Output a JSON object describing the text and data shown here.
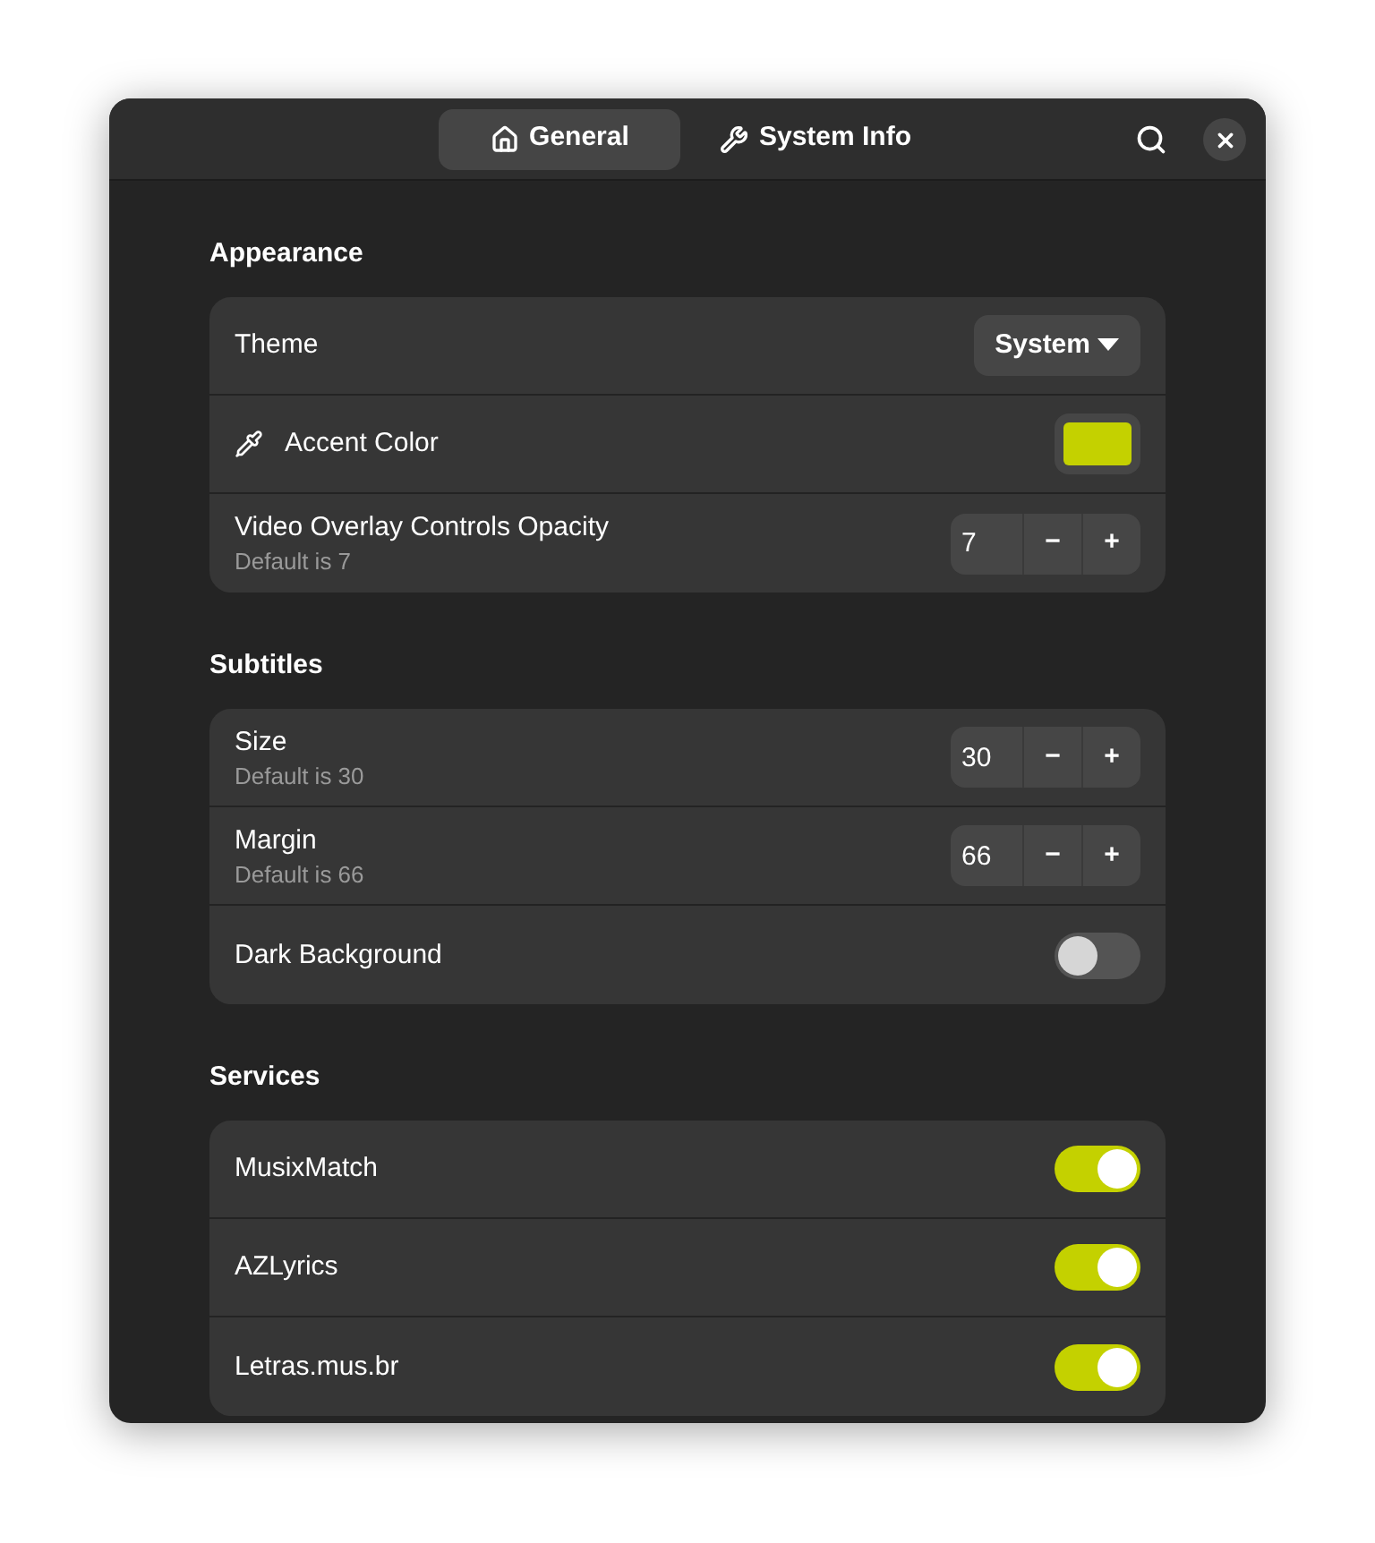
{
  "header": {
    "tabs": [
      {
        "label": "General",
        "kind": "home",
        "selected": true
      },
      {
        "label": "System Info",
        "kind": "tool",
        "selected": false
      }
    ]
  },
  "sections": [
    {
      "title": "Appearance",
      "rows": [
        {
          "kind": "dropdown",
          "label": "Theme",
          "value": "System"
        },
        {
          "kind": "color",
          "label": "Accent Color",
          "color": "#c4d100"
        },
        {
          "kind": "spin",
          "label": "Video Overlay Controls Opacity",
          "subtitle": "Default is 7",
          "value": "7",
          "minus": "−",
          "plus": "+"
        }
      ]
    },
    {
      "title": "Subtitles",
      "rows": [
        {
          "kind": "spin",
          "label": "Size",
          "subtitle": "Default is 30",
          "value": "30",
          "minus": "−",
          "plus": "+"
        },
        {
          "kind": "spin",
          "label": "Margin",
          "subtitle": "Default is 66",
          "value": "66",
          "minus": "−",
          "plus": "+"
        },
        {
          "kind": "switch",
          "label": "Dark Background",
          "on": false
        }
      ]
    },
    {
      "title": "Services",
      "rows": [
        {
          "kind": "switch",
          "label": "MusixMatch",
          "on": true
        },
        {
          "kind": "switch",
          "label": "AZLyrics",
          "on": true
        },
        {
          "kind": "switch",
          "label": "Letras.mus.br",
          "on": true
        }
      ]
    }
  ]
}
